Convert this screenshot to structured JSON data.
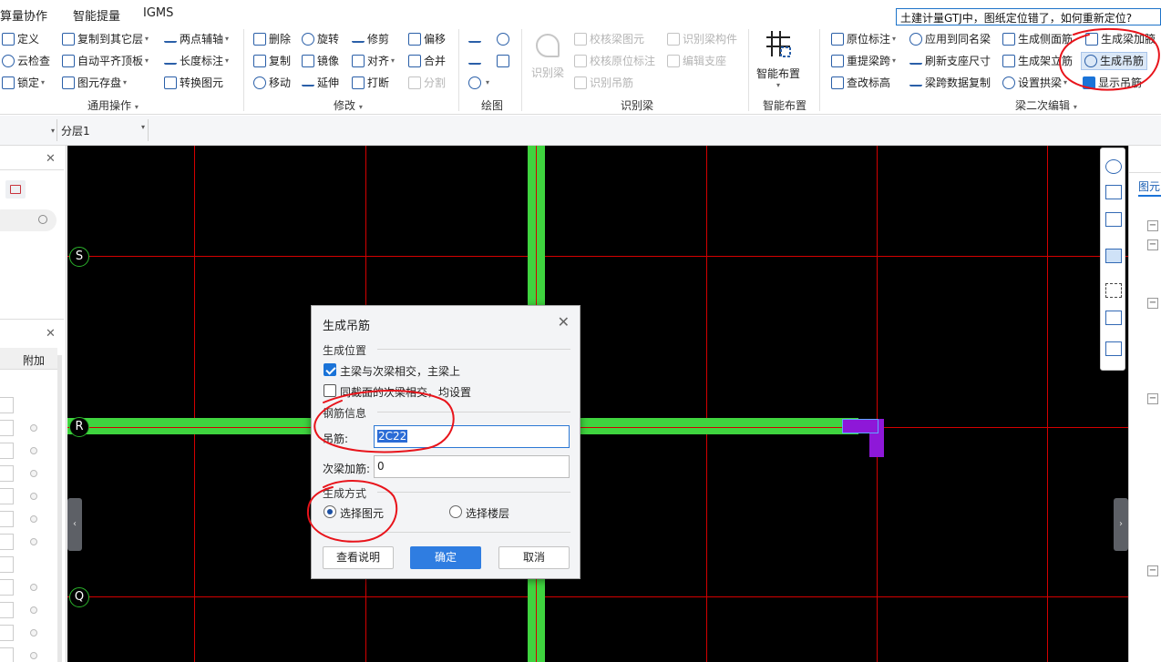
{
  "menu": {
    "items": [
      "算量协作",
      "智能提量",
      "IGMS"
    ],
    "search_value": "土建计量GTJ中，图纸定位错了，如何重新定位?"
  },
  "ribbon": {
    "general": {
      "buttons": [
        "定义",
        "云检查",
        "锁定",
        "复制到其它层",
        "自动平齐顶板",
        "图元存盘",
        "两点辅轴",
        "长度标注",
        "转换图元"
      ],
      "label": "通用操作"
    },
    "modify": {
      "buttons": [
        "删除",
        "复制",
        "移动",
        "旋转",
        "镜像",
        "延伸",
        "修剪",
        "对齐",
        "打断",
        "偏移",
        "合并",
        "分割"
      ],
      "label": "修改"
    },
    "draw": {
      "label": "绘图"
    },
    "recognize": {
      "big": "识别梁",
      "buttons": [
        "校核梁图元",
        "校核原位标注",
        "识别吊筋",
        "识别梁构件",
        "编辑支座"
      ],
      "label": "识别梁"
    },
    "smart": {
      "big": "智能布置",
      "label": "智能布置"
    },
    "beam2": {
      "buttons": [
        "原位标注",
        "重提梁跨",
        "查改标高",
        "应用到同名梁",
        "刷新支座尺寸",
        "梁跨数据复制",
        "生成侧面筋",
        "生成架立筋",
        "设置拱梁",
        "生成梁加腋",
        "生成吊筋",
        "显示吊筋"
      ],
      "label": "梁二次编辑"
    }
  },
  "layerbar": {
    "layer": "分层1"
  },
  "leftpanel": {
    "header": "附加"
  },
  "canvas": {
    "axes": [
      "S",
      "R",
      "Q"
    ]
  },
  "dialog": {
    "title": "生成吊筋",
    "section_position": "生成位置",
    "opt_main_secondary": "主梁与次梁相交，主梁上",
    "opt_same_section": "同截面的次梁相交，均设置",
    "section_rebar": "钢筋信息",
    "hanger_label": "吊筋:",
    "hanger_value": "2C22",
    "secondary_label": "次梁加筋:",
    "secondary_value": "0",
    "section_method": "生成方式",
    "method_select_element": "选择图元",
    "method_select_floor": "选择楼层",
    "btn_help": "查看说明",
    "btn_ok": "确定",
    "btn_cancel": "取消"
  },
  "rightpanel": {
    "tab": "图元"
  }
}
